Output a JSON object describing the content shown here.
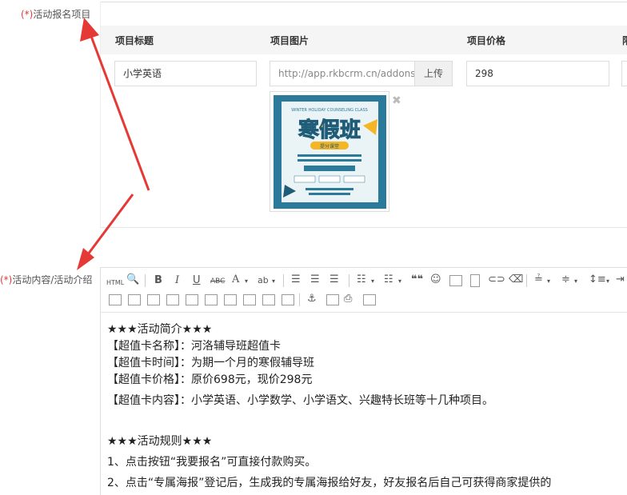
{
  "labels": {
    "req_mark": "(*)",
    "items_label": "活动报名项目",
    "content_label": "活动内容/活动介绍"
  },
  "table": {
    "headers": [
      "项目标题",
      "项目图片",
      "项目价格",
      "限"
    ],
    "row": {
      "title": "小学英语",
      "image_url": "http://app.rkbcrm.cn/addons/l",
      "upload_label": "上传",
      "price": "298"
    }
  },
  "poster": {
    "top_text": "WINTER HOLIDAY COUNSELING CLASS",
    "title": "寒假班",
    "badge": "提分课堂"
  },
  "toolbar": {
    "html_label": "HTML",
    "bold": "B",
    "italic": "I",
    "underline": "U",
    "strike": "ABC",
    "font_color": "A",
    "quote": "❝❝"
  },
  "content": {
    "lines": [
      "★★★活动简介★★★",
      "【超值卡名称】：河洛辅导班超值卡",
      "【超值卡时间】：为期一个月的寒假辅导班",
      "【超值卡价格】：原价698元，现价298元",
      "【超值卡内容】：小学英语、小学数学、小学语文、兴趣特长班等十几种项目。",
      "",
      "★★★活动规则★★★",
      "1、点击按钮“我要报名”可直接付款购买。",
      "2、点击“专属海报”登记后，生成我的专属海报给好友，好友报名后自己可获得商家提供的"
    ]
  },
  "colors": {
    "required": "#e4393c",
    "arrow": "#e53935",
    "poster_bg": "#2b7a9c"
  }
}
